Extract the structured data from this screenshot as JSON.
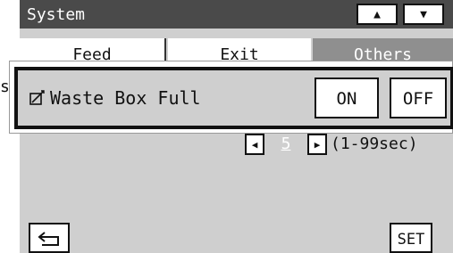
{
  "header": {
    "title": "System",
    "scroll_up_icon": "up-triangle-icon",
    "scroll_down_icon": "down-triangle-icon"
  },
  "tabs": [
    {
      "label": "Feed",
      "active": false
    },
    {
      "label": "Exit",
      "active": false
    },
    {
      "label": "Others",
      "active": true
    }
  ],
  "setting": {
    "label": "Waste Box Full",
    "icon": "edit-checkbox-icon",
    "on_label": "ON",
    "off_label": "OFF"
  },
  "number_setting": {
    "value": "5",
    "range": "(1-99sec)",
    "decrement_icon": "left-triangle-icon",
    "increment_icon": "right-triangle-icon"
  },
  "footer": {
    "back_icon": "return-arrow-icon",
    "set_label": "SET"
  },
  "edge_glyph": "s",
  "colors": {
    "title_bar": "#4a4a4a",
    "panel": "#cfcfcf",
    "active_tab": "#8f8f8f",
    "button": "#ffffff"
  }
}
